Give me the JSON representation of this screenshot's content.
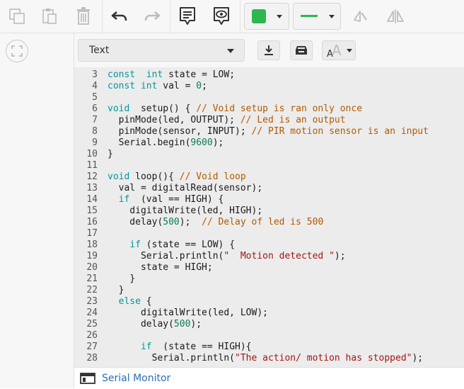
{
  "toolbar": {
    "icons": [
      "duplicate-icon",
      "paste-icon",
      "trash-icon",
      "undo-icon",
      "redo-icon",
      "notes-icon",
      "view-icon",
      "fill-color-icon",
      "stroke-style-icon",
      "flip-icon",
      "mirror-icon"
    ],
    "colors": {
      "fill": "#2db84d",
      "stroke": "#2db84d",
      "icon": "#333333",
      "disabled": "#b8b8b8"
    }
  },
  "code_panel": {
    "mode_select": {
      "value": "Text"
    },
    "buttons": [
      "download-icon",
      "upload-icon",
      "font-size-icon"
    ]
  },
  "code": {
    "lines": [
      {
        "n": "3",
        "text": "const  int state = LOW;"
      },
      {
        "n": "4",
        "text": "const int val = 0;"
      },
      {
        "n": "5",
        "text": ""
      },
      {
        "n": "6",
        "text": "void  setup() { // Void setup is ran only once"
      },
      {
        "n": "7",
        "text": "  pinMode(led, OUTPUT); // Led is an output"
      },
      {
        "n": "8",
        "text": "  pinMode(sensor, INPUT); // PIR motion sensor is an input"
      },
      {
        "n": "9",
        "text": "  Serial.begin(9600);"
      },
      {
        "n": "10",
        "text": "}"
      },
      {
        "n": "11",
        "text": ""
      },
      {
        "n": "12",
        "text": "void loop(){ // Void loop"
      },
      {
        "n": "13",
        "text": "  val = digitalRead(sensor);"
      },
      {
        "n": "14",
        "text": "  if  (val == HIGH) {"
      },
      {
        "n": "15",
        "text": "    digitalWrite(led, HIGH);"
      },
      {
        "n": "16",
        "text": "    delay(500);  // Delay of led is 500"
      },
      {
        "n": "17",
        "text": ""
      },
      {
        "n": "18",
        "text": "    if (state == LOW) {"
      },
      {
        "n": "19",
        "text": "      Serial.println(\"  Motion detected \");"
      },
      {
        "n": "20",
        "text": "      state = HIGH;"
      },
      {
        "n": "21",
        "text": "    }"
      },
      {
        "n": "22",
        "text": "  }"
      },
      {
        "n": "23",
        "text": "  else {"
      },
      {
        "n": "24",
        "text": "      digitalWrite(led, LOW);"
      },
      {
        "n": "25",
        "text": "      delay(500);"
      },
      {
        "n": "26",
        "text": ""
      },
      {
        "n": "27",
        "text": "      if  (state == HIGH){"
      },
      {
        "n": "28",
        "text": "        Serial.println(\"The action/ motion has stopped\");"
      }
    ]
  },
  "status": {
    "serial_monitor": "Serial Monitor"
  }
}
